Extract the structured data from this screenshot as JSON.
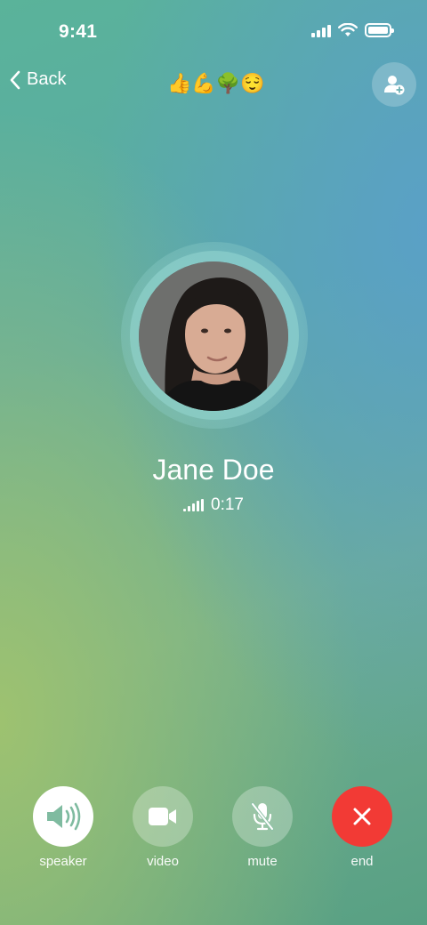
{
  "status_bar": {
    "time": "9:41"
  },
  "nav": {
    "back_label": "Back",
    "emoji_status": "👍💪🌳😌"
  },
  "caller": {
    "name": "Jane Doe",
    "duration": "0:17"
  },
  "controls": [
    {
      "id": "speaker",
      "label": "speaker",
      "icon": "speaker-icon"
    },
    {
      "id": "video",
      "label": "video",
      "icon": "video-camera-icon"
    },
    {
      "id": "mute",
      "label": "mute",
      "icon": "microphone-off-icon"
    },
    {
      "id": "end",
      "label": "end",
      "icon": "close-icon"
    }
  ],
  "colors": {
    "end_call": "#f23a35",
    "speaker_active": "#ffffff",
    "icon_tint": "#7fbba0"
  }
}
